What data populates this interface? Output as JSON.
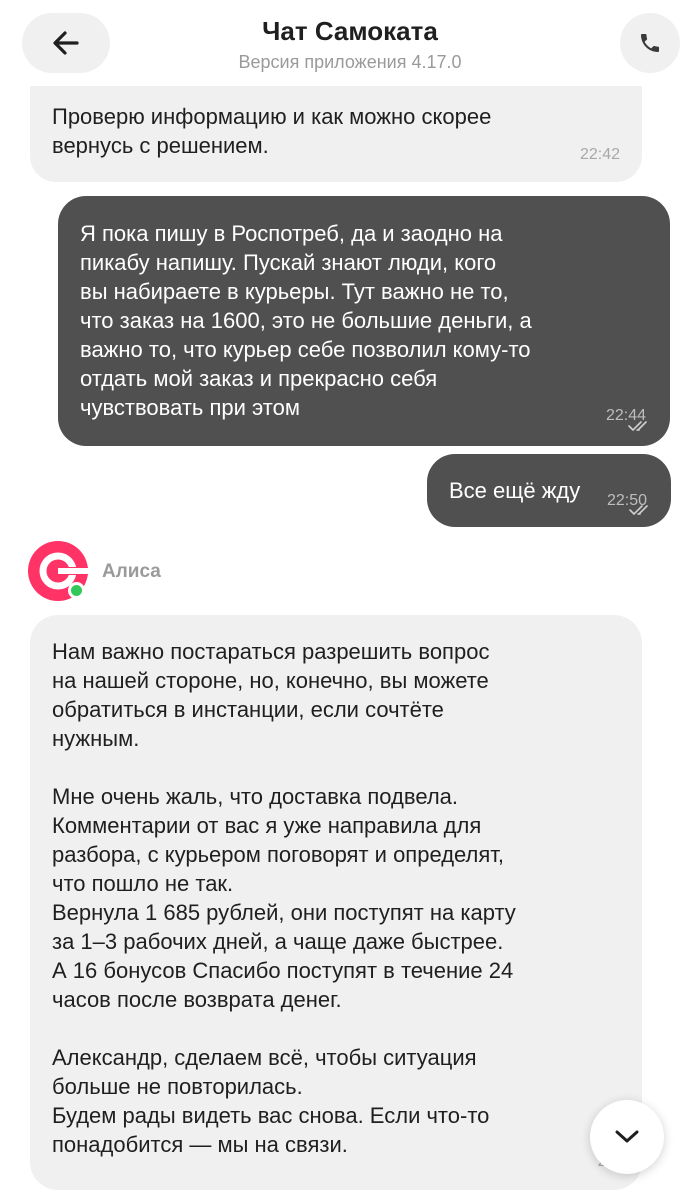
{
  "header": {
    "title": "Чат Самоката",
    "subtitle": "Версия приложения 4.17.0",
    "back_icon": "arrow-left-icon",
    "call_icon": "phone-icon"
  },
  "messages": [
    {
      "direction": "incoming",
      "text": "Проверю информацию и как можно скорее\nвернусь с решением.",
      "time": "22:42"
    },
    {
      "direction": "outgoing",
      "text": "Я пока пишу в Роспотреб, да и заодно на\nпикабу напишу. Пускай знают люди, кого\nвы набираете в курьеры. Тут важно не то,\nчто заказ на 1600, это не большие деньги, а\nважно то, что курьер себе позволил кому-то\nотдать мой заказ и прекрасно себя\nчувствовать при этом",
      "time": "22:44",
      "status": "read"
    },
    {
      "direction": "outgoing",
      "text": "Все ещё жду",
      "time": "22:50",
      "status": "read"
    },
    {
      "direction": "incoming",
      "text": "Нам важно постараться разрешить вопрос\nна нашей стороне, но, конечно, вы можете\nобратиться в инстанции, если сочтёте\nнужным.\n\nМне очень жаль, что доставка подвела.\nКомментарии от вас я уже направила для\nразбора, с курьером поговорят и определят,\nчто пошло не так.\nВернула 1 685 рублей, они поступят на карту\nза 1–3 рабочих дней, а чаще даже быстрее.\nА 16 бонусов Спасибо поступят в течение 24\nчасов после возврата денег.\n\nАлександр, сделаем всё, чтобы ситуация\nбольше не повторилась.\nБудем рады видеть вас снова. Если что-то\nпонадобится — мы на связи.",
      "time": "22:"
    }
  ],
  "agent": {
    "name": "Алиса",
    "status": "online",
    "avatar_icon": "samokat-logo-icon"
  },
  "colors": {
    "incoming_bubble": "#f0f0f0",
    "outgoing_bubble": "#505050",
    "brand": "#ff3366",
    "online": "#34c759"
  },
  "controls": {
    "scroll_down_icon": "chevron-down-icon"
  }
}
